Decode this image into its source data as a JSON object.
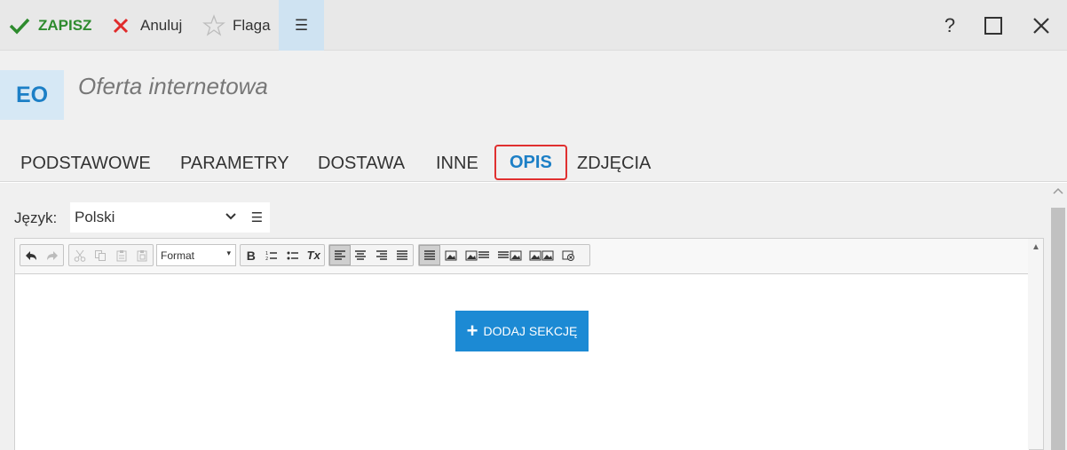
{
  "toolbar": {
    "save_label": "ZAPISZ",
    "cancel_label": "Anuluj",
    "flag_label": "Flaga",
    "menu_glyph": "☰",
    "help_glyph": "?",
    "maximize_glyph": "☐",
    "close_glyph": "✕",
    "save_color": "#2e8b2e",
    "cancel_color": "#e02b2b"
  },
  "header": {
    "avatar": "EO",
    "title": "Oferta internetowa"
  },
  "tabs": [
    {
      "label": "PODSTAWOWE"
    },
    {
      "label": "PARAMETRY"
    },
    {
      "label": "DOSTAWA"
    },
    {
      "label": "INNE"
    },
    {
      "label": "OPIS",
      "active": true
    },
    {
      "label": "ZDJĘCIA"
    }
  ],
  "language": {
    "label": "Język:",
    "value": "Polski"
  },
  "editor": {
    "format_label": "Format",
    "add_section_label": "DODAJ SEKCJĘ",
    "bold_glyph": "B",
    "clear_format_glyph": "Tx"
  },
  "colors": {
    "accent": "#1c7fc6",
    "button": "#1c8ad4",
    "highlight_border": "#e03030"
  }
}
